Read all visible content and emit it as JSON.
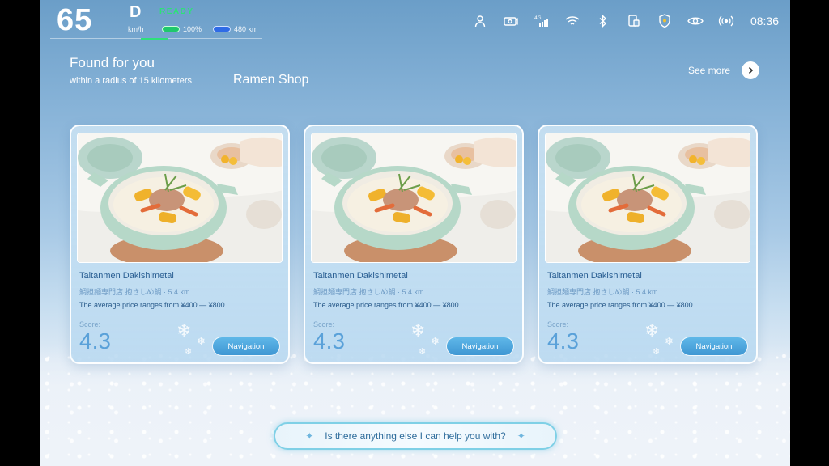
{
  "status_bar": {
    "speed": "65",
    "speed_unit": "km/h",
    "gear": "D",
    "ready_label": "READY",
    "battery_percent": "100%",
    "range": "480 km",
    "time": "08:36",
    "icons": [
      "person-icon",
      "camera-icon",
      "signal-4g-icon",
      "wifi-icon",
      "bluetooth-icon",
      "phone-link-icon",
      "shield-icon",
      "eye-icon",
      "broadcast-icon"
    ]
  },
  "header": {
    "title": "Found for you",
    "subtitle": "within a radius of 15 kilometers",
    "category": "Ramen Shop",
    "see_more_label": "See more"
  },
  "cards": [
    {
      "name": "Taitanmen Dakishimetai",
      "subtitle": "鯛担麺専門店 抱きしめ鯛",
      "distance": "5.4 km",
      "price": "The average price ranges from ¥400 — ¥800",
      "score_label": "Score:",
      "score": "4.3",
      "nav_label": "Navigation"
    },
    {
      "name": "Taitanmen Dakishimetai",
      "subtitle": "鯛担麺専門店 抱きしめ鯛",
      "distance": "5.4 km",
      "price": "The average price ranges from ¥400 — ¥800",
      "score_label": "Score:",
      "score": "4.3",
      "nav_label": "Navigation"
    },
    {
      "name": "Taitanmen Dakishimetai",
      "subtitle": "鯛担麺専門店 抱きしめ鯛",
      "distance": "5.4 km",
      "price": "The average price ranges from ¥400 — ¥800",
      "score_label": "Score:",
      "score": "4.3",
      "nav_label": "Navigation"
    }
  ],
  "assistant": {
    "prompt": "Is there anything else I can help you with?"
  },
  "colors": {
    "ready": "#2ee07a",
    "nav_button": "#4aa7de",
    "score": "#5aa1d9",
    "assistant_border": "#7fd0e6"
  }
}
